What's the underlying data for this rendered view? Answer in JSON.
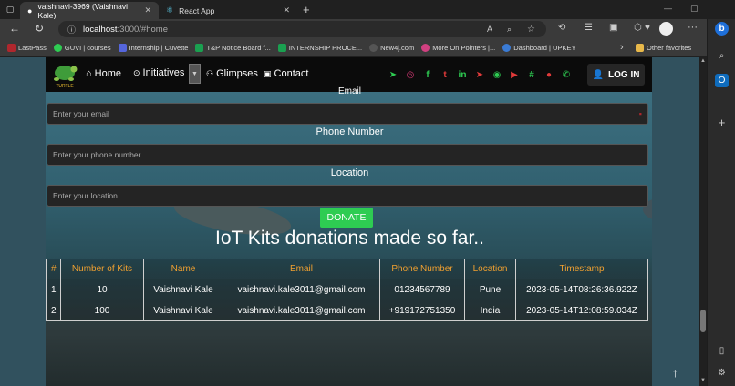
{
  "browser": {
    "tabs": [
      {
        "title": "vaishnavi-3969 (Vaishnavi Kale)",
        "icon": "github-icon"
      },
      {
        "title": "React App",
        "icon": "react-icon"
      }
    ],
    "new_tab": "+",
    "url_host": "localhost",
    "url_path": ":3000/#home",
    "favorites": [
      {
        "label": "LastPass",
        "color": "#b0272d"
      },
      {
        "label": "GUVI | courses",
        "color": "#2ecc52"
      },
      {
        "label": "Internship | Cuvette",
        "color": "#5566dd"
      },
      {
        "label": "T&P Notice Board f...",
        "color": "#1aa050"
      },
      {
        "label": "INTERNSHIP PROCE...",
        "color": "#1aa050"
      },
      {
        "label": "New4j.com",
        "color": "#555555"
      },
      {
        "label": "More On Pointers |...",
        "color": "#d04080"
      },
      {
        "label": "Dashboard | UPKEY",
        "color": "#3a7bd5"
      }
    ],
    "other_favorites": "Other favorites",
    "more": "›"
  },
  "nav": {
    "logo_text": "TURTLE",
    "home": "Home",
    "initiatives": "Initiatives",
    "glimpses": "Glimpses",
    "contact": "Contact",
    "login": "LOG IN",
    "social": [
      {
        "glyph": "➤",
        "color": "#2ecc52"
      },
      {
        "glyph": "◎",
        "color": "#e03a7a"
      },
      {
        "glyph": "f",
        "color": "#2ecc52"
      },
      {
        "glyph": "t",
        "color": "#e03a3a"
      },
      {
        "glyph": "in",
        "color": "#2ecc52"
      },
      {
        "glyph": "➤",
        "color": "#e03a3a"
      },
      {
        "glyph": "◉",
        "color": "#2ecc52"
      },
      {
        "glyph": "▶",
        "color": "#e03a3a"
      },
      {
        "glyph": "#",
        "color": "#2ecc52"
      },
      {
        "glyph": "●",
        "color": "#e03a3a"
      },
      {
        "glyph": "✆",
        "color": "#2ecc52"
      }
    ]
  },
  "form": {
    "email_label": "Email",
    "email_placeholder": "Enter your email",
    "phone_label": "Phone Number",
    "phone_placeholder": "Enter your phone number",
    "location_label": "Location",
    "location_placeholder": "Enter your location",
    "donate": "DONATE"
  },
  "heading": "IoT Kits donations made so far..",
  "table": {
    "headers": [
      "#",
      "Number of Kits",
      "Name",
      "Email",
      "Phone Number",
      "Location",
      "Timestamp"
    ],
    "rows": [
      [
        "1",
        "10",
        "Vaishnavi Kale",
        "vaishnavi.kale3011@gmail.com",
        "01234567789",
        "Pune",
        "2023-05-14T08:26:36.922Z"
      ],
      [
        "2",
        "100",
        "Vaishnavi Kale",
        "vaishnavi.kale3011@gmail.com",
        "+919172751350",
        "India",
        "2023-05-14T12:08:59.034Z"
      ]
    ]
  },
  "colors": {
    "accent_green": "#2ecc52",
    "header_orange": "#f0a030"
  }
}
